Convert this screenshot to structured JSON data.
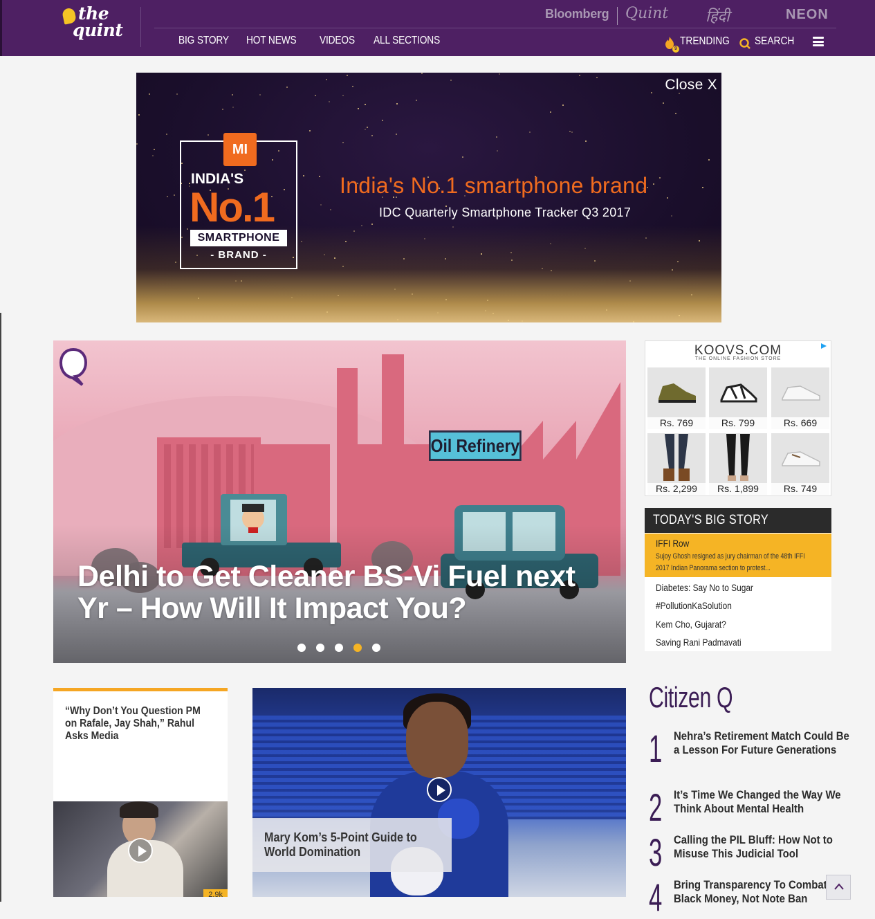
{
  "header": {
    "logo_line1": "the",
    "logo_line2": "quint",
    "partners": {
      "bloomberg": "Bloomberg",
      "quint": "Quint",
      "hindi": "हिंदी",
      "neon": "NEON"
    },
    "nav": [
      "BIG STORY",
      "HOT NEWS",
      "VIDEOS",
      "ALL SECTIONS"
    ],
    "trending_label": "TRENDING",
    "trending_count": "9",
    "search_label": "SEARCH",
    "colors": {
      "bar": "#4e2063",
      "accent": "#f5b425"
    }
  },
  "ad_banner": {
    "close_label": "Close X",
    "brand_mark": "MI",
    "badge_line1": "INDIA'S",
    "badge_line2": "No.1",
    "badge_line3": "SMARTPHONE",
    "badge_line4": "- BRAND -",
    "headline": "India's No.1 smartphone brand",
    "subline": "IDC Quarterly Smartphone Tracker Q3 2017"
  },
  "hero": {
    "sign_text": "Oil Refinery",
    "title": "Delhi to Get Cleaner BS-Vi Fuel next Yr – How Will It Impact You?",
    "slides": 5,
    "active_slide": 4
  },
  "koovs_ad": {
    "brand": "KOOVS.COM",
    "tagline": "THE ONLINE FASHION STORE",
    "products": [
      {
        "price": "Rs. 769",
        "icon": "sneaker-icon"
      },
      {
        "price": "Rs. 799",
        "icon": "sandal-icon"
      },
      {
        "price": "Rs. 669",
        "icon": "white-shoe-icon"
      },
      {
        "price": "Rs. 2,299",
        "icon": "jeans-boots-icon"
      },
      {
        "price": "Rs. 1,899",
        "icon": "black-jeans-icon"
      },
      {
        "price": "Rs. 749",
        "icon": "white-shoe-icon"
      }
    ]
  },
  "big_story": {
    "heading": "TODAY'S BIG STORY",
    "active": {
      "title": "IFFI Row",
      "desc": "Sujoy Ghosh resigned as jury chairman of the 48th IFFI 2017 Indian Panorama section to protest..."
    },
    "items": [
      "Diabetes: Say No to Sugar",
      "#PollutionKaSolution",
      "Kem Cho, Gujarat?",
      "Saving Rani Padmavati"
    ]
  },
  "cards": {
    "rahul": {
      "title": "“Why Don’t You Question PM on Rafale, Jay Shah,” Rahul Asks Media",
      "views": "2.9k"
    },
    "marykom": {
      "caption": "Mary Kom’s 5-Point Guide to World Domination"
    }
  },
  "citizen_q": {
    "heading": "Citizen Q",
    "items": [
      {
        "num": "1",
        "text": "Nehra’s Retirement Match Could Be a Lesson For Future Generations"
      },
      {
        "num": "2",
        "text": "It’s Time We Changed the Way We Think About Mental Health"
      },
      {
        "num": "3",
        "text": "Calling the PIL Bluff: How Not to Misuse This Judicial Tool"
      },
      {
        "num": "4",
        "text": "Bring Transparency To Combat Black Money, Not Note Ban"
      }
    ]
  }
}
